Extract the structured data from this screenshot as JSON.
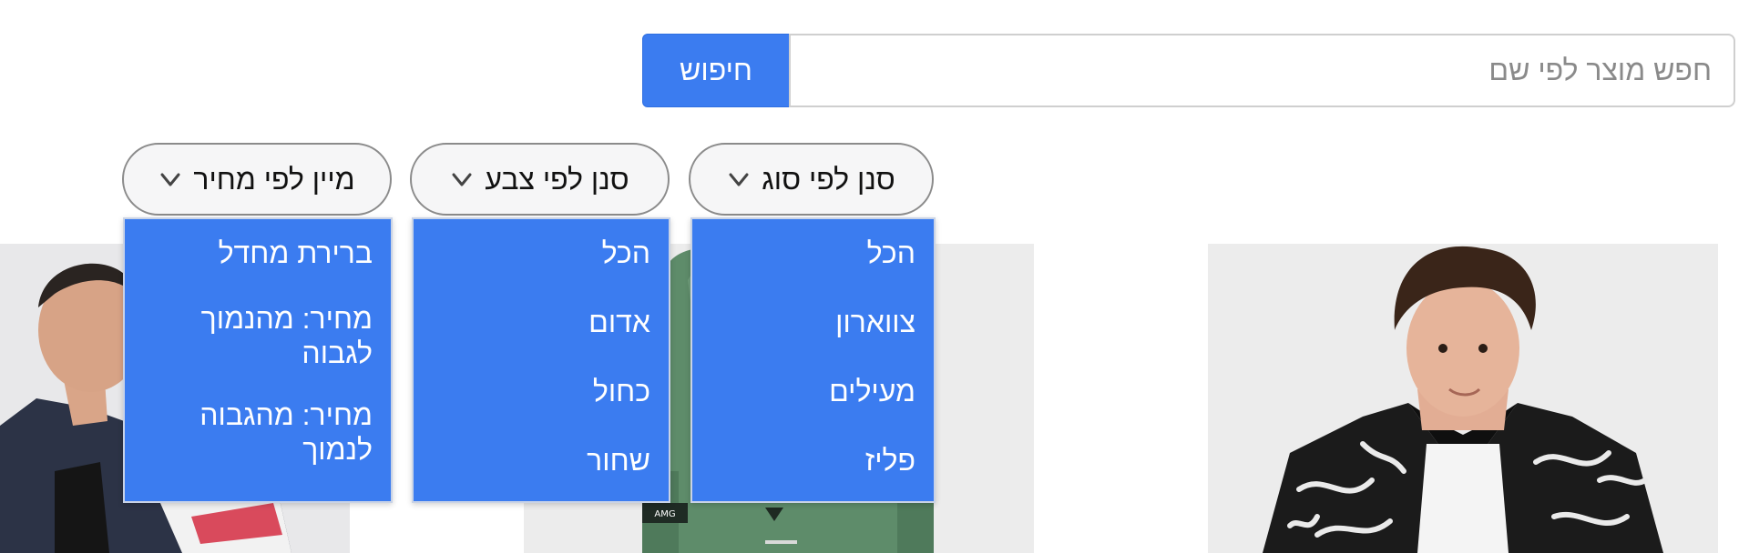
{
  "search": {
    "button_label": "חיפוש",
    "placeholder": "חפש מוצר לפי שם",
    "value": ""
  },
  "filters": {
    "type": {
      "label": "סנן לפי סוג",
      "options": [
        "הכל",
        "צווארון",
        "מעילים",
        "פליז"
      ]
    },
    "color": {
      "label": "סנן לפי צבע",
      "options": [
        "הכל",
        "אדום",
        "כחול",
        "שחור"
      ]
    },
    "price": {
      "label": "מיין לפי מחיר",
      "options": [
        "ברירת מחדל",
        "מחיר: מהנמוך לגבוה",
        "מחיר: מהגבוה לנמוך"
      ]
    }
  },
  "icons": {
    "chevron": "chevron-down-icon"
  },
  "colors": {
    "accent": "#3b7cf0",
    "dropdown_bg": "#3b7cf0",
    "button_bg": "#f6f6f7"
  }
}
